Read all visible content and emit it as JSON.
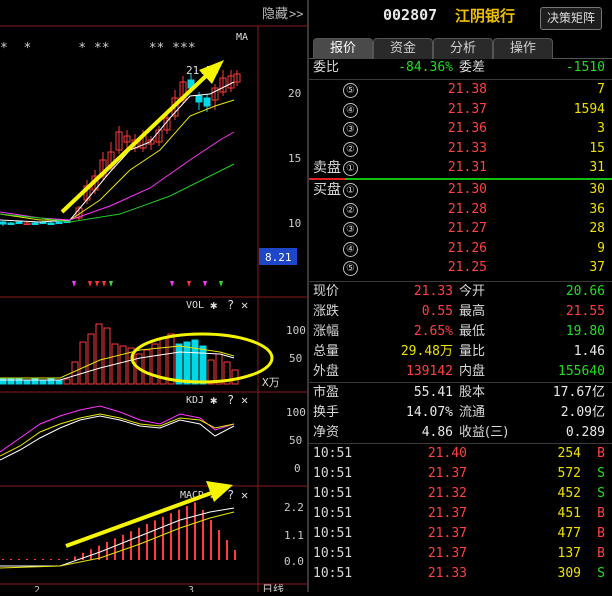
{
  "left": {
    "top_bar": {
      "hide_label": "隐藏",
      "expand_icon": "double-chevron-right-icon",
      "ma_label": "MA",
      "star_marks": "*  *      * **     ** ***"
    },
    "price_axis": [
      "20",
      "15",
      "10"
    ],
    "current_price_badge": "8.21",
    "price_annotation": "21.55",
    "vol_panel": {
      "title": "VOL",
      "axis": [
        "100",
        "50"
      ],
      "unit": "X万"
    },
    "kdj_panel": {
      "title": "KDJ",
      "axis": [
        "100",
        "50",
        "0"
      ]
    },
    "macd_panel": {
      "title": "MACD",
      "axis": [
        "2.2",
        "1.1",
        "0.0"
      ]
    },
    "bottom": {
      "date_a": "2",
      "date_b": "3",
      "period_label": "日线"
    }
  },
  "right": {
    "code": "002807",
    "name": "江阴银行",
    "matrix_button": "决策矩阵",
    "tabs": [
      "报价",
      "资金",
      "分析",
      "操作"
    ],
    "ratio": {
      "wb_label": "委比",
      "wb_value": "-84.36%",
      "wc_label": "委差",
      "wc_value": "-1510"
    },
    "sell": [
      {
        "level": "⑤",
        "price": "21.38",
        "vol": "7"
      },
      {
        "level": "④",
        "price": "21.37",
        "vol": "1594"
      },
      {
        "level": "③",
        "price": "21.36",
        "vol": "3"
      },
      {
        "level": "②",
        "price": "21.33",
        "vol": "15"
      },
      {
        "level": "①",
        "price": "21.31",
        "vol": "31",
        "label": "卖盘"
      }
    ],
    "buy": [
      {
        "level": "①",
        "price": "21.30",
        "vol": "30",
        "label": "买盘"
      },
      {
        "level": "②",
        "price": "21.28",
        "vol": "36"
      },
      {
        "level": "③",
        "price": "21.27",
        "vol": "28"
      },
      {
        "level": "④",
        "price": "21.26",
        "vol": "9"
      },
      {
        "level": "⑤",
        "price": "21.25",
        "vol": "37"
      }
    ],
    "quote": [
      {
        "l1": "现价",
        "v1": "21.33",
        "c1": "red",
        "l2": "今开",
        "v2": "20.66",
        "c2": "green"
      },
      {
        "l1": "涨跌",
        "v1": "0.55",
        "c1": "red",
        "l2": "最高",
        "v2": "21.55",
        "c2": "red"
      },
      {
        "l1": "涨幅",
        "v1": "2.65%",
        "c1": "red",
        "l2": "最低",
        "v2": "19.80",
        "c2": "green"
      },
      {
        "l1": "总量",
        "v1": "29.48万",
        "c1": "yellow",
        "l2": "量比",
        "v2": "1.46",
        "c2": "white"
      },
      {
        "l1": "外盘",
        "v1": "139142",
        "c1": "red",
        "l2": "内盘",
        "v2": "155640",
        "c2": "green"
      }
    ],
    "fundamentals": [
      {
        "l1": "市盈",
        "v1": "55.41",
        "l2": "股本",
        "v2": "17.67亿"
      },
      {
        "l1": "换手",
        "v1": "14.07%",
        "l2": "流通",
        "v2": "2.09亿"
      },
      {
        "l1": "净资",
        "v1": "4.86",
        "l2": "收益(三)",
        "v2": "0.289"
      }
    ],
    "ticks": [
      {
        "time": "10:51",
        "price": "21.40",
        "vol": "254",
        "side": "B"
      },
      {
        "time": "10:51",
        "price": "21.37",
        "vol": "572",
        "side": "S"
      },
      {
        "time": "10:51",
        "price": "21.32",
        "vol": "452",
        "side": "S"
      },
      {
        "time": "10:51",
        "price": "21.37",
        "vol": "451",
        "side": "B"
      },
      {
        "time": "10:51",
        "price": "21.37",
        "vol": "477",
        "side": "B"
      },
      {
        "time": "10:51",
        "price": "21.37",
        "vol": "137",
        "side": "B"
      },
      {
        "time": "10:51",
        "price": "21.33",
        "vol": "309",
        "side": "S"
      }
    ]
  }
}
